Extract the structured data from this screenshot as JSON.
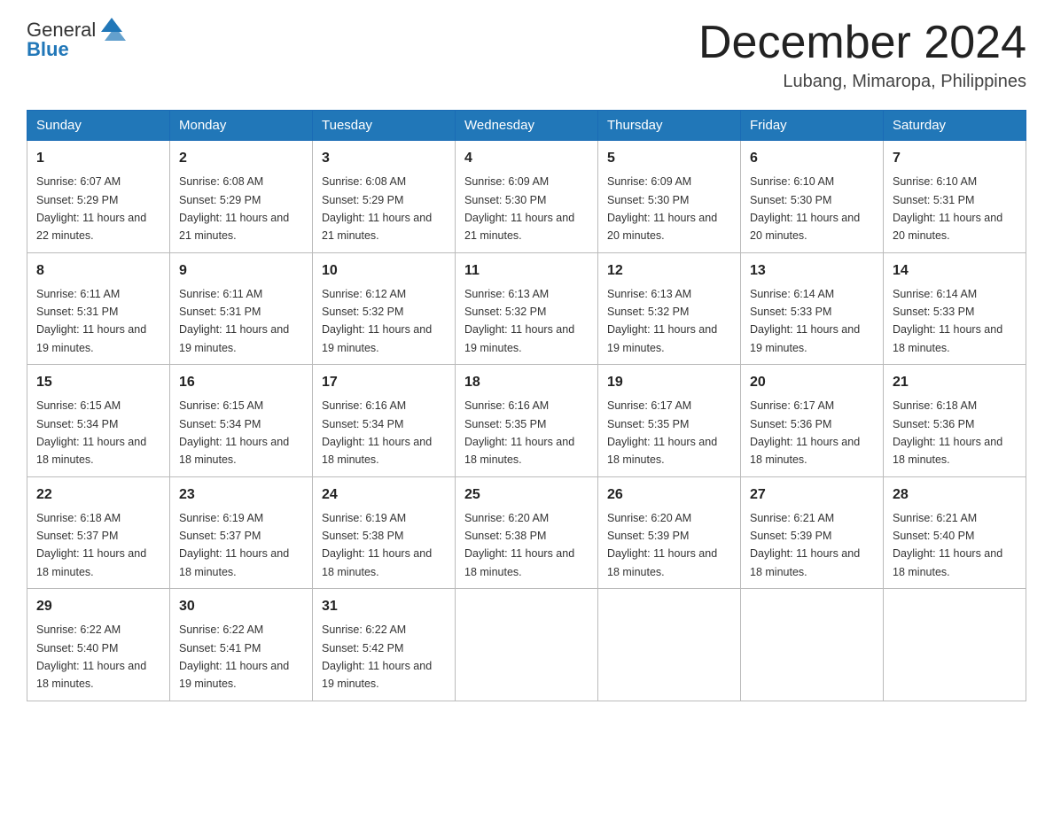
{
  "header": {
    "logo_text_general": "General",
    "logo_text_blue": "Blue",
    "month_title": "December 2024",
    "location": "Lubang, Mimaropa, Philippines"
  },
  "days_of_week": [
    "Sunday",
    "Monday",
    "Tuesday",
    "Wednesday",
    "Thursday",
    "Friday",
    "Saturday"
  ],
  "weeks": [
    [
      {
        "day": "1",
        "sunrise": "6:07 AM",
        "sunset": "5:29 PM",
        "daylight": "11 hours and 22 minutes."
      },
      {
        "day": "2",
        "sunrise": "6:08 AM",
        "sunset": "5:29 PM",
        "daylight": "11 hours and 21 minutes."
      },
      {
        "day": "3",
        "sunrise": "6:08 AM",
        "sunset": "5:29 PM",
        "daylight": "11 hours and 21 minutes."
      },
      {
        "day": "4",
        "sunrise": "6:09 AM",
        "sunset": "5:30 PM",
        "daylight": "11 hours and 21 minutes."
      },
      {
        "day": "5",
        "sunrise": "6:09 AM",
        "sunset": "5:30 PM",
        "daylight": "11 hours and 20 minutes."
      },
      {
        "day": "6",
        "sunrise": "6:10 AM",
        "sunset": "5:30 PM",
        "daylight": "11 hours and 20 minutes."
      },
      {
        "day": "7",
        "sunrise": "6:10 AM",
        "sunset": "5:31 PM",
        "daylight": "11 hours and 20 minutes."
      }
    ],
    [
      {
        "day": "8",
        "sunrise": "6:11 AM",
        "sunset": "5:31 PM",
        "daylight": "11 hours and 19 minutes."
      },
      {
        "day": "9",
        "sunrise": "6:11 AM",
        "sunset": "5:31 PM",
        "daylight": "11 hours and 19 minutes."
      },
      {
        "day": "10",
        "sunrise": "6:12 AM",
        "sunset": "5:32 PM",
        "daylight": "11 hours and 19 minutes."
      },
      {
        "day": "11",
        "sunrise": "6:13 AM",
        "sunset": "5:32 PM",
        "daylight": "11 hours and 19 minutes."
      },
      {
        "day": "12",
        "sunrise": "6:13 AM",
        "sunset": "5:32 PM",
        "daylight": "11 hours and 19 minutes."
      },
      {
        "day": "13",
        "sunrise": "6:14 AM",
        "sunset": "5:33 PM",
        "daylight": "11 hours and 19 minutes."
      },
      {
        "day": "14",
        "sunrise": "6:14 AM",
        "sunset": "5:33 PM",
        "daylight": "11 hours and 18 minutes."
      }
    ],
    [
      {
        "day": "15",
        "sunrise": "6:15 AM",
        "sunset": "5:34 PM",
        "daylight": "11 hours and 18 minutes."
      },
      {
        "day": "16",
        "sunrise": "6:15 AM",
        "sunset": "5:34 PM",
        "daylight": "11 hours and 18 minutes."
      },
      {
        "day": "17",
        "sunrise": "6:16 AM",
        "sunset": "5:34 PM",
        "daylight": "11 hours and 18 minutes."
      },
      {
        "day": "18",
        "sunrise": "6:16 AM",
        "sunset": "5:35 PM",
        "daylight": "11 hours and 18 minutes."
      },
      {
        "day": "19",
        "sunrise": "6:17 AM",
        "sunset": "5:35 PM",
        "daylight": "11 hours and 18 minutes."
      },
      {
        "day": "20",
        "sunrise": "6:17 AM",
        "sunset": "5:36 PM",
        "daylight": "11 hours and 18 minutes."
      },
      {
        "day": "21",
        "sunrise": "6:18 AM",
        "sunset": "5:36 PM",
        "daylight": "11 hours and 18 minutes."
      }
    ],
    [
      {
        "day": "22",
        "sunrise": "6:18 AM",
        "sunset": "5:37 PM",
        "daylight": "11 hours and 18 minutes."
      },
      {
        "day": "23",
        "sunrise": "6:19 AM",
        "sunset": "5:37 PM",
        "daylight": "11 hours and 18 minutes."
      },
      {
        "day": "24",
        "sunrise": "6:19 AM",
        "sunset": "5:38 PM",
        "daylight": "11 hours and 18 minutes."
      },
      {
        "day": "25",
        "sunrise": "6:20 AM",
        "sunset": "5:38 PM",
        "daylight": "11 hours and 18 minutes."
      },
      {
        "day": "26",
        "sunrise": "6:20 AM",
        "sunset": "5:39 PM",
        "daylight": "11 hours and 18 minutes."
      },
      {
        "day": "27",
        "sunrise": "6:21 AM",
        "sunset": "5:39 PM",
        "daylight": "11 hours and 18 minutes."
      },
      {
        "day": "28",
        "sunrise": "6:21 AM",
        "sunset": "5:40 PM",
        "daylight": "11 hours and 18 minutes."
      }
    ],
    [
      {
        "day": "29",
        "sunrise": "6:22 AM",
        "sunset": "5:40 PM",
        "daylight": "11 hours and 18 minutes."
      },
      {
        "day": "30",
        "sunrise": "6:22 AM",
        "sunset": "5:41 PM",
        "daylight": "11 hours and 19 minutes."
      },
      {
        "day": "31",
        "sunrise": "6:22 AM",
        "sunset": "5:42 PM",
        "daylight": "11 hours and 19 minutes."
      },
      null,
      null,
      null,
      null
    ]
  ],
  "label_sunrise": "Sunrise:",
  "label_sunset": "Sunset:",
  "label_daylight": "Daylight:"
}
